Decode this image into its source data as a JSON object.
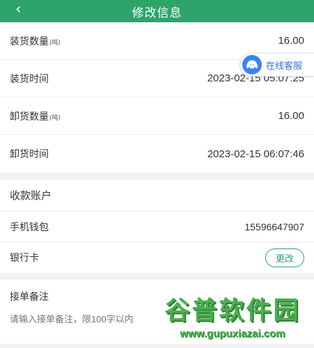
{
  "header": {
    "title": "修改信息",
    "back_icon": "chevron-left-icon"
  },
  "loading": {
    "quantity_label": "装货数量",
    "quantity_unit": "(吨)",
    "quantity_value": "16.00",
    "time_label": "装货时间",
    "time_value": "2023-02-15 05:07:25"
  },
  "unloading": {
    "quantity_label": "卸货数量",
    "quantity_unit": "(吨)",
    "quantity_value": "16.00",
    "time_label": "卸货时间",
    "time_value": "2023-02-15 06:07:46"
  },
  "account": {
    "title": "收款账户",
    "wallet_label": "手机钱包",
    "wallet_value": "15596647907",
    "bank_label": "银行卡",
    "change_label": "更改"
  },
  "remark": {
    "label": "接单备注",
    "placeholder": "请输入接单备注，限100字以内"
  },
  "customer_service": {
    "label": "在线客服"
  },
  "watermark": {
    "text": "谷普软件园",
    "url": "www.gupuxiazai.com"
  },
  "colors": {
    "brand": "#2ea36a",
    "cs_blue": "#2f6fe0"
  }
}
